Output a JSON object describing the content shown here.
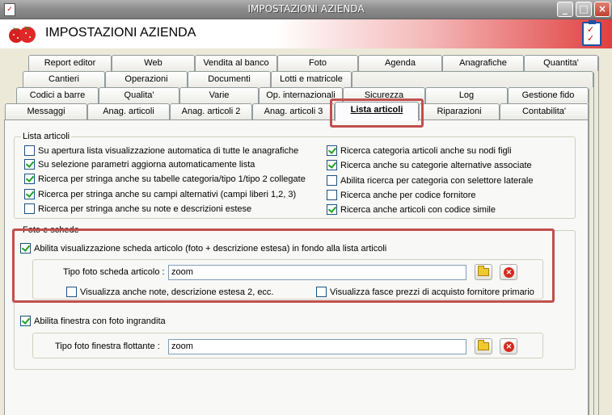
{
  "window": {
    "title": "IMPOSTAZIONI AZIENDA",
    "minimize": "_",
    "maximize": "□",
    "close": "×"
  },
  "header": {
    "title": "IMPOSTAZIONI AZIENDA"
  },
  "tabs": {
    "row1": [
      "Report editor",
      "Web",
      "Vendita al banco",
      "Foto",
      "Agenda",
      "Anagrafiche",
      "Quantita'"
    ],
    "row2": [
      "Cantieri",
      "Operazioni",
      "Documenti",
      "Lotti e matricole"
    ],
    "row3": [
      "Codici a barre",
      "Qualita'",
      "Varie",
      "Op. internazionali",
      "Sicurezza",
      "Log",
      "Gestione fido"
    ],
    "row4": [
      "Messaggi",
      "Anag. articoli",
      "Anag. articoli 2",
      "Anag. articoli 3",
      "Lista articoli",
      "Riparazioni",
      "Contabilita'"
    ]
  },
  "lista_articoli": {
    "title": "Lista articoli",
    "left": [
      {
        "label": "Su apertura lista visualizzazione automatica di tutte le anagrafiche",
        "checked": false
      },
      {
        "label": "Su selezione parametri aggiorna automaticamente lista",
        "checked": true
      },
      {
        "label": "Ricerca per stringa anche su tabelle categoria/tipo 1/tipo 2 collegate",
        "checked": true
      },
      {
        "label": "Ricerca per stringa anche su campi alternativi (campi liberi 1,2, 3)",
        "checked": true
      },
      {
        "label": "Ricerca per stringa anche su note e descrizioni estese",
        "checked": false
      }
    ],
    "right": [
      {
        "label": "Ricerca categoria articoli anche su nodi figli",
        "checked": true
      },
      {
        "label": "Ricerca anche su categorie alternative associate",
        "checked": true
      },
      {
        "label": "Abilita ricerca per categoria con selettore laterale",
        "checked": false
      },
      {
        "label": "Ricerca anche per codice fornitore",
        "checked": false
      },
      {
        "label": "Ricerca anche articoli con codice simile",
        "checked": true
      }
    ]
  },
  "foto_schede": {
    "title": "Foto e schede",
    "abilita_scheda": {
      "label": "Abilita visualizzazione scheda articolo (foto + descrizione estesa) in fondo alla lista articoli",
      "checked": true
    },
    "tipo_foto_scheda": {
      "label": "Tipo foto scheda articolo :",
      "value": "zoom"
    },
    "visualizza_note": {
      "label": "Visualizza anche note, descrizione estesa 2, ecc.",
      "checked": false
    },
    "visualizza_fasce": {
      "label": "Visualizza fasce prezzi di acquisto fornitore primario",
      "checked": false
    },
    "abilita_finestra": {
      "label": "Abilita finestra con foto ingrandita",
      "checked": true
    },
    "tipo_foto_finestra": {
      "label": "Tipo foto finestra flottante :",
      "value": "zoom"
    }
  }
}
